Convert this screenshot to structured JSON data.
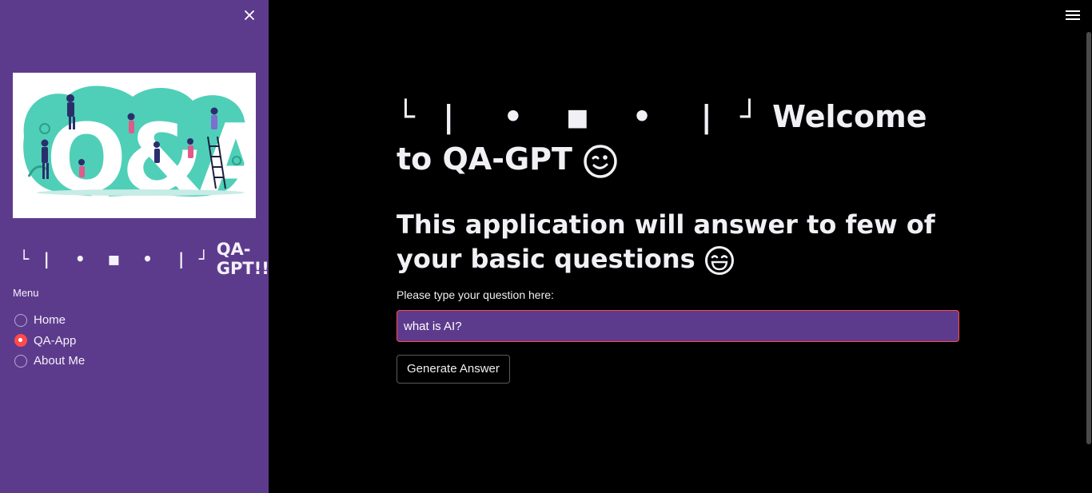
{
  "sidebar": {
    "close_icon": "close-icon",
    "title_glyphs": "└ |  •  ■  •  | ┘",
    "title_text": "QA-GPT!!",
    "menu_label": "Menu",
    "items": [
      {
        "label": "Home",
        "checked": false
      },
      {
        "label": "QA-App",
        "checked": true
      },
      {
        "label": "About Me",
        "checked": false
      }
    ]
  },
  "main": {
    "heading_glyphs": "└ |  •  ■  •  | ┘",
    "heading_text": "Welcome to QA-GPT",
    "subheading": "This application will answer to few of your basic questions",
    "input_label": "Please type your question here:",
    "input_value": "what is AI?",
    "button_label": "Generate Answer"
  },
  "colors": {
    "sidebar_bg": "#5d3b8c",
    "main_bg": "#000000",
    "accent": "#ff4b4b",
    "logo_teal": "#4fcfb8"
  },
  "icons": {
    "menu": "hamburger-menu-icon",
    "wink": "winking-face-icon",
    "grin": "grinning-face-icon"
  }
}
